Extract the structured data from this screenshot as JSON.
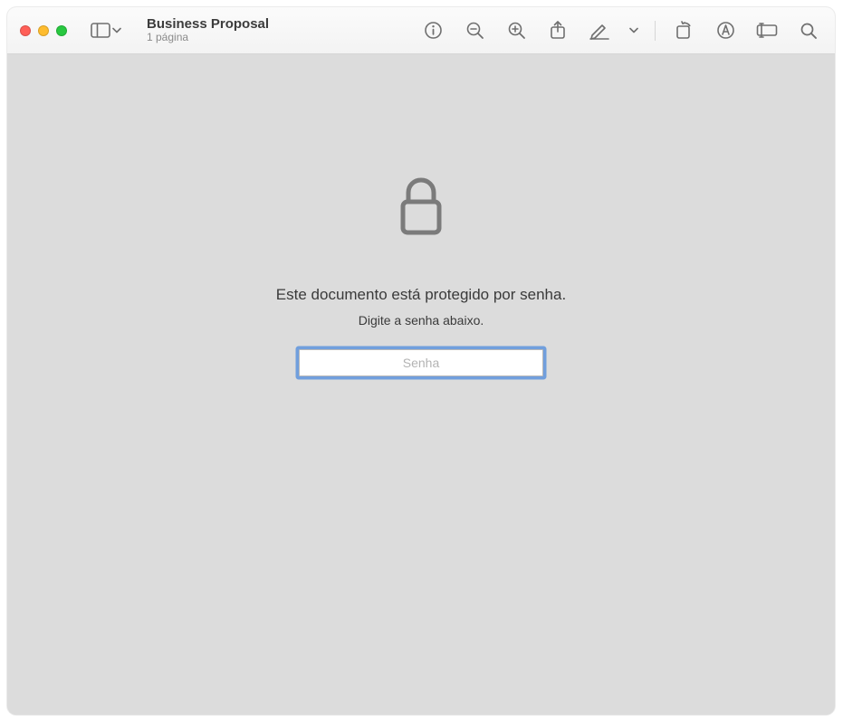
{
  "window": {
    "title": "Business Proposal",
    "subtitle": "1 página"
  },
  "locked": {
    "headline": "Este documento está protegido por senha.",
    "instruction": "Digite a senha abaixo.",
    "placeholder": "Senha",
    "value": ""
  }
}
